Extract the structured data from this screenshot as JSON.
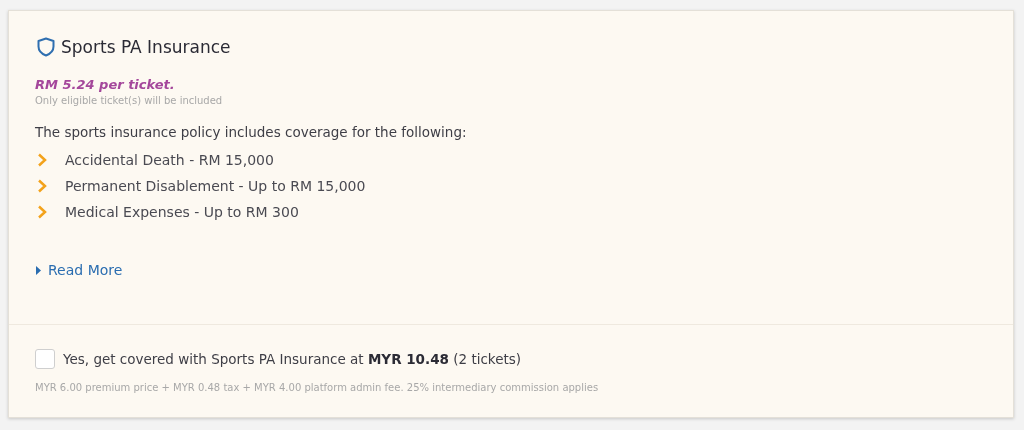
{
  "card": {
    "title": "Sports PA Insurance",
    "price": "RM 5.24 per ticket.",
    "eligibility_note": "Only eligible ticket(s) will be included",
    "intro": "The sports insurance policy includes coverage for the following:",
    "coverage": [
      "Accidental Death - RM 15,000",
      "Permanent Disablement - Up to RM 15,000",
      "Medical Expenses - Up to RM 300"
    ],
    "read_more": {
      "label": "Read More",
      "expanded": false
    }
  },
  "opt_in": {
    "checked": false,
    "label": "Yes, get covered with Sports PA Insurance at **MYR 10.48** (2 tickets)",
    "fee_note": "MYR 6.00 premium price + MYR 0.48 tax + MYR 4.00 platform admin fee. 25% intermediary commission applies"
  }
}
